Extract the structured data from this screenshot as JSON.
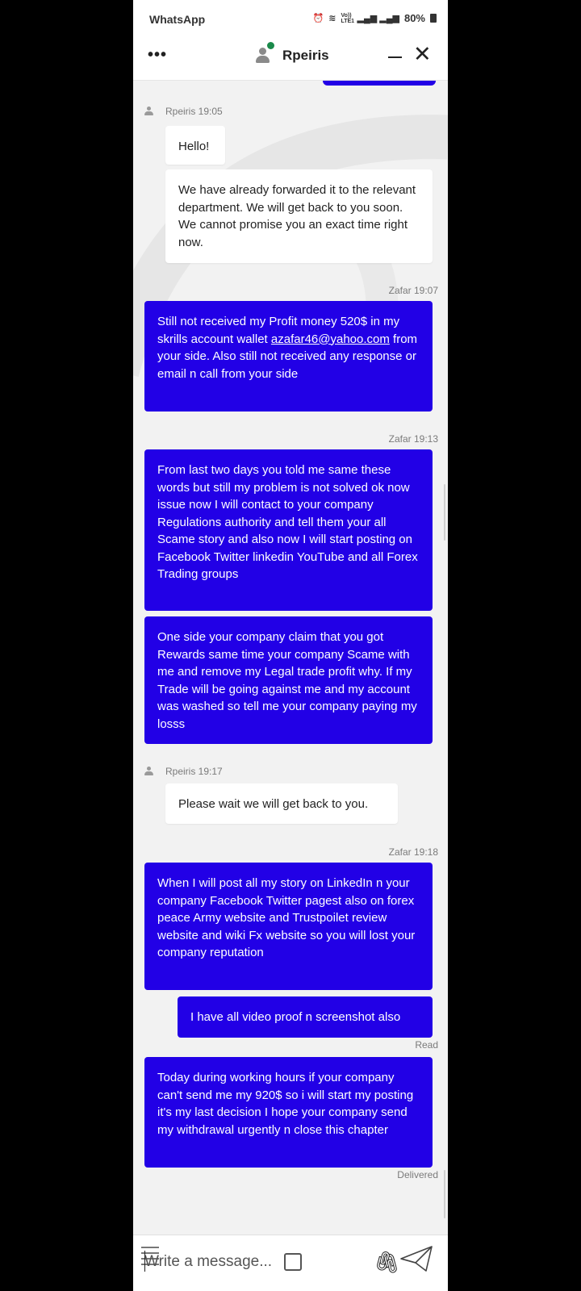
{
  "status_bar": {
    "app_name": "WhatsApp",
    "alarm_icon": "alarm-icon",
    "network_text": "Vo)) LTE1",
    "battery": "80%"
  },
  "header": {
    "agent_name": "Rpeiris",
    "menu_label": "•••",
    "close_label": "✕",
    "status_color": "#1a8a4a"
  },
  "colors": {
    "outgoing_bubble": "#2200e6",
    "incoming_bubble": "#ffffff",
    "background": "#f2f2f2"
  },
  "messages": [
    {
      "sender": "Rpeiris",
      "time": "19:05",
      "header": "Rpeiris 19:05"
    },
    {
      "text": "Hello!"
    },
    {
      "text": "We have already forwarded it to the relevant department. We will get back to you soon. We cannot promise you an exact time right now."
    },
    {
      "header": "Zafar 19:07"
    },
    {
      "text_before_link": "Still not received my Profit money 520$ in my skrills account wallet ",
      "link": "azafar46@yahoo.com",
      "text_after_link": " from your side. Also still not received any response or email n call from your side"
    },
    {
      "header": "Zafar 19:13"
    },
    {
      "text": "From last two days you told me same these words but still my problem is not solved ok now issue now I will contact to your company Regulations authority and tell them your all Scame story and also now I will start posting on Facebook Twitter linkedin YouTube and all Forex Trading groups"
    },
    {
      "text": "One side your company claim that you got Rewards same time your company Scame with me and remove my Legal trade profit why. If my Trade will be going against me and my account was washed so tell me your company paying my losss"
    },
    {
      "header": "Rpeiris 19:17"
    },
    {
      "text": "Please wait we will get back to you."
    },
    {
      "header": "Zafar 19:18"
    },
    {
      "text": "When I will post all my story on LinkedIn n your company Facebook Twitter pagest also on forex peace Army website and Trustpoilet review website and wiki Fx website so you will lost your company reputation"
    },
    {
      "text": "I have all video proof n screenshot also"
    },
    {
      "receipt": "Read"
    },
    {
      "text": "Today during working hours if your company can't send me my 920$ so i will start my posting it's my last decision I hope your company send my withdrawal urgently n close this chapter"
    },
    {
      "receipt": "Delivered"
    }
  ],
  "composer": {
    "placeholder": "Write a message...",
    "emoji_icon": "menu-lines-icon",
    "attach_icon": "paperclip-icon",
    "send_icon": "send-icon"
  }
}
